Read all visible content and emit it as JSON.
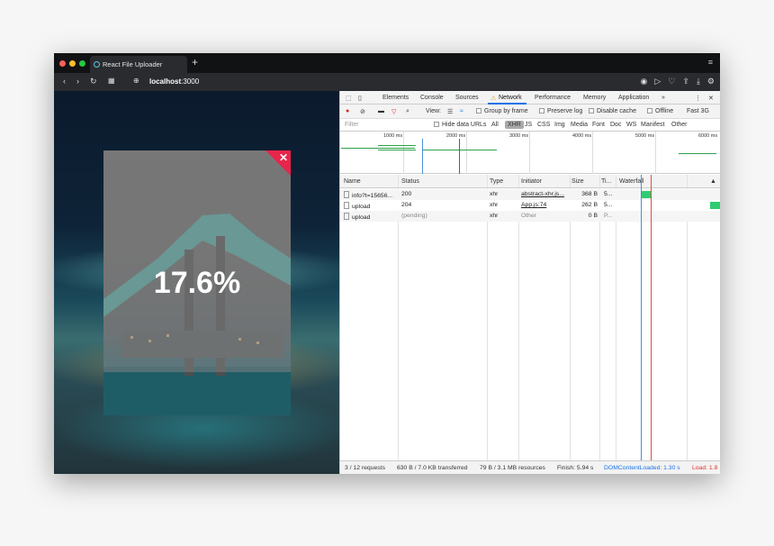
{
  "browser": {
    "tab_title": "React File Uploader",
    "new_tab": "+",
    "url_host": "localhost",
    "url_port": ":3000",
    "traffic_colors": [
      "#fe5f57",
      "#febc2e",
      "#28c840"
    ]
  },
  "upload": {
    "progress_text": "17.6%",
    "close_symbol": "✕",
    "accent": "#e8254b"
  },
  "devtools": {
    "tabs": [
      "Elements",
      "Console",
      "Sources",
      "Network",
      "Performance",
      "Memory",
      "Application",
      "»"
    ],
    "active_tab": "Network",
    "view_label": "View:",
    "group_by_frame": "Group by frame",
    "preserve_log": "Preserve log",
    "disable_cache": "Disable cache",
    "offline": "Offline",
    "throttle": "Fast 3G",
    "filter_placeholder": "Filter",
    "hide_data_urls": "Hide data URLs",
    "type_filters": [
      "All",
      "XHR",
      "JS",
      "CSS",
      "Img",
      "Media",
      "Font",
      "Doc",
      "WS",
      "Manifest",
      "Other"
    ],
    "timeline_ticks": [
      "1000 ms",
      "2000 ms",
      "3000 ms",
      "4000 ms",
      "5000 ms",
      "6000 ms"
    ],
    "columns": [
      "Name",
      "Status",
      "Type",
      "Initiator",
      "Size",
      "Ti...",
      "Waterfall",
      "▲"
    ],
    "rows": [
      {
        "name": "info?t=15656...",
        "status": "200",
        "type": "xhr",
        "initiator": "abstract-xhr.js...",
        "size": "368 B",
        "time": "5..."
      },
      {
        "name": "upload",
        "status": "204",
        "type": "xhr",
        "initiator": "App.js:74",
        "size": "262 B",
        "time": "5..."
      },
      {
        "name": "upload",
        "status": "(pending)",
        "type": "xhr",
        "initiator": "Other",
        "size": "0 B",
        "time": "P..."
      }
    ],
    "status_bar": {
      "requests": "3 / 12 requests",
      "transferred": "630 B / 7.0 KB transferred",
      "resources": "79 B / 3.1 MB resources",
      "finish": "Finish: 5.94 s",
      "dcl": "DOMContentLoaded: 1.30 s",
      "load": "Load: 1.8"
    }
  }
}
